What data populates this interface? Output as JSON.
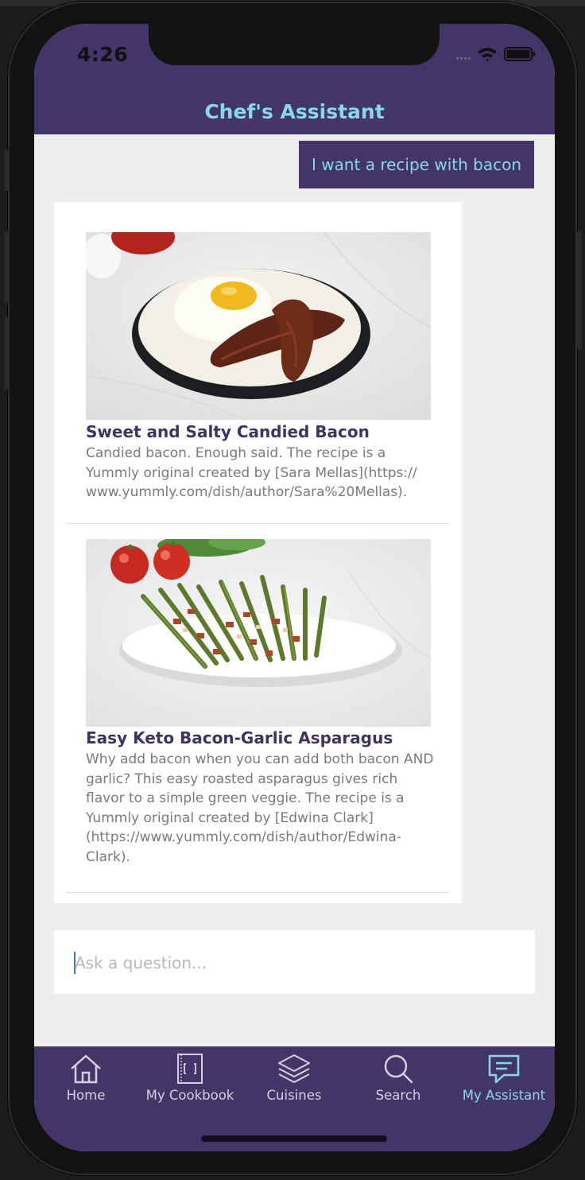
{
  "status_bar": {
    "time": "4:26"
  },
  "header": {
    "title": "Chef's Assistant"
  },
  "conversation": {
    "user_message": "I want a recipe with bacon",
    "recipes": [
      {
        "title": "Sweet and Salty Candied Bacon",
        "description": "Candied bacon. Enough said. The recipe is a Yummly original created by [Sara Mellas](https:// www.yummly.com/dish/author/Sara%20Mellas).",
        "image": "fried-egg-and-candied-bacon-plate"
      },
      {
        "title": "Easy Keto Bacon-Garlic Asparagus",
        "description": "Why add bacon when you can add both bacon AND garlic? This easy roasted asparagus gives rich flavor to a simple green veggie. The recipe is a Yummly original created by [Edwina Clark] (https://www.yummly.com/dish/author/Edwina-Clark).",
        "image": "bacon-garlic-asparagus-platter"
      }
    ]
  },
  "input": {
    "placeholder": "Ask a question...",
    "value": ""
  },
  "tabs": [
    {
      "label": "Home",
      "icon": "home-icon",
      "active": false
    },
    {
      "label": "My Cookbook",
      "icon": "cookbook-icon",
      "active": false
    },
    {
      "label": "Cuisines",
      "icon": "layers-icon",
      "active": false
    },
    {
      "label": "Search",
      "icon": "search-icon",
      "active": false
    },
    {
      "label": "My Assistant",
      "icon": "chat-icon",
      "active": true
    }
  ],
  "colors": {
    "brand": "#433567",
    "accent": "#8ad6ec",
    "background": "#efeeed",
    "title_text": "#403360",
    "body_text": "#7a7a7a"
  }
}
